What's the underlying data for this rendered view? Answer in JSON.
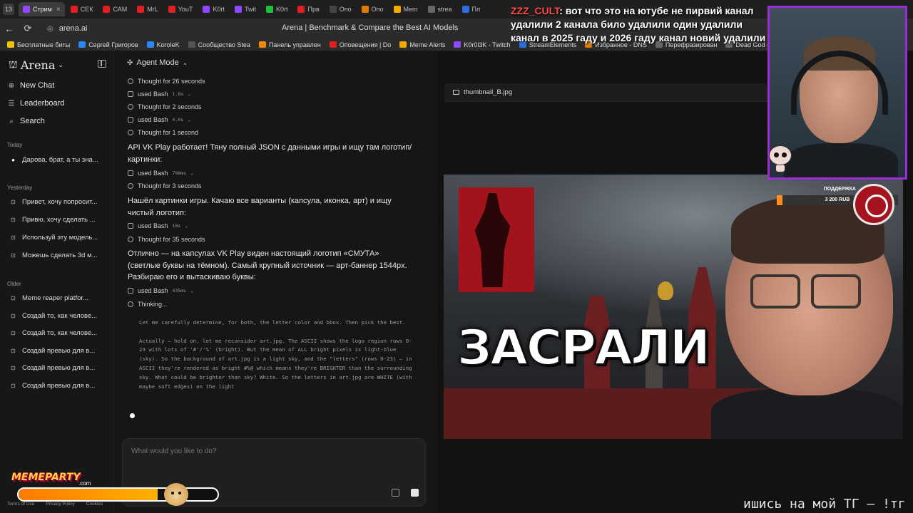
{
  "browser": {
    "tab_count": "13",
    "tabs": [
      {
        "label": "Стрим",
        "color": "#9146ff",
        "active": true
      },
      {
        "label": "СЕК",
        "color": "#e02020"
      },
      {
        "label": "САМ",
        "color": "#e02020"
      },
      {
        "label": "MrL",
        "color": "#e02020"
      },
      {
        "label": "YouT",
        "color": "#e02020"
      },
      {
        "label": "K0rt",
        "color": "#9146ff"
      },
      {
        "label": "Twit",
        "color": "#9146ff"
      },
      {
        "label": "K0rt",
        "color": "#1fbf3a"
      },
      {
        "label": "Прв",
        "color": "#e02020"
      },
      {
        "label": "Опо",
        "color": "#444"
      },
      {
        "label": "Опо",
        "color": "#e07b00"
      },
      {
        "label": "Mem",
        "color": "#f2a900"
      },
      {
        "label": "strea",
        "color": "#666"
      },
      {
        "label": "Пл",
        "color": "#2a6fe0"
      }
    ],
    "url": "arena.ai",
    "page_title": "Arena | Benchmark & Compare the Best AI Models",
    "bookmarks": [
      {
        "label": "Бесплатные биты",
        "color": "#f2c300"
      },
      {
        "label": "Сергей Григоров",
        "color": "#2787f5"
      },
      {
        "label": "KoroleK",
        "color": "#2787f5"
      },
      {
        "label": "Сообщество Stea",
        "color": "#555"
      },
      {
        "label": "Панель управлен",
        "color": "#f08a00"
      },
      {
        "label": "Оповещения | Do",
        "color": "#e02020"
      },
      {
        "label": "Meme Alerts",
        "color": "#f2a900"
      },
      {
        "label": "K0r0l3K - Twitch",
        "color": "#9146ff"
      },
      {
        "label": "StreamElements",
        "color": "#2a6fe0"
      },
      {
        "label": "Избранное - DNS",
        "color": "#e07b00"
      },
      {
        "label": "Перефразирован",
        "color": "#666"
      },
      {
        "label": "Dead God – Прох",
        "color": "#666"
      }
    ]
  },
  "sidebar": {
    "brand": "Arena",
    "nav": [
      {
        "label": "New Chat",
        "icon": "plus-circle-icon"
      },
      {
        "label": "Leaderboard",
        "icon": "list-icon"
      },
      {
        "label": "Search",
        "icon": "search-icon"
      }
    ],
    "sections": {
      "today": "Today",
      "yesterday": "Yesterday",
      "older": "Older"
    },
    "today_items": [
      "Дарова, брат, а ты зна..."
    ],
    "yesterday_items": [
      "Привет, хочу попросит...",
      "Привю, хочу сделать ...",
      "Используй эту модель...",
      "Можешь сделать 3d м..."
    ],
    "older_items": [
      "Meme reaper platfor...",
      "Создай то, как челове...",
      "Создай то, как челове...",
      "Создай превью для в...",
      "Создай превью для в...",
      "Создай превью для в..."
    ],
    "footer": [
      "Terms of Use",
      "Privacy Policy",
      "Cookies"
    ]
  },
  "chat": {
    "mode": "Agent Mode",
    "steps": [
      {
        "text": "Thought for 26 seconds"
      },
      {
        "text": "used Bash",
        "meta": "1.8s"
      },
      {
        "text": "Thought for 2 seconds"
      },
      {
        "text": "used Bash",
        "meta": "4.0s"
      },
      {
        "text": "Thought for 1 second"
      }
    ],
    "para1": "API VK Play работает! Тяну полный JSON с данными игры и ищу там логотип/картинки:",
    "steps2": [
      {
        "text": "used Bash",
        "meta": "708ms"
      },
      {
        "text": "Thought for 3 seconds"
      }
    ],
    "para2": "Нашёл картинки игры. Качаю все варианты (капсула, иконка, арт) и ищу чистый логотип:",
    "steps3": [
      {
        "text": "used Bash",
        "meta": "10s"
      },
      {
        "text": "Thought for 35 seconds"
      }
    ],
    "para3": "Отлично — на капсулах VK Play виден настоящий логотип «СМУТА» (светлые буквы на тёмном). Самый крупный источник — арт-баннер 1544px. Разбираю его и вытаскиваю буквы:",
    "steps4": [
      {
        "text": "used Bash",
        "meta": "435ms"
      },
      {
        "text": "Thinking..."
      }
    ],
    "thinking": "Let me carefully determine, for both, the letter color and bbox. Then pick the best.\n\nActually — hold on, let me reconsider art.jpg. The ASCII shows the logo region rows 0-23 with lots of '#'/'%' (bright). But the mean of ALL bright pixels is light-blue (sky). So the background of art.jpg is a light sky, and the \"letters\" (rows 0-23) — in ASCII they're rendered as bright #%@ which means they're BRIGHTER than the surrounding sky. What could be brighter than sky? White. So the letters in art.jpg are WHITE (with maybe soft edges) on the light",
    "composer_placeholder": "What would you like to do?"
  },
  "preview": {
    "filename": "thumbnail_B.jpg",
    "headline": "ЗАСРАЛИ"
  },
  "overlay": {
    "chat_user": "ZZZ_CULT",
    "chat_message": ": вот что это на ютубе не пирвий канал удалили 2 канала било удалили один удалили канал в 2025 гаду и 2026 гаду канал новий удалили",
    "donate_label": "ПОДДЕРЖКА",
    "donate_amount": "3 200 RUB",
    "memeparty": "MEMEPARTY",
    "memeparty_sub": ".com",
    "memeparty_progress": 0.7,
    "ticker": "ишись на мой ТГ – !тг По"
  }
}
